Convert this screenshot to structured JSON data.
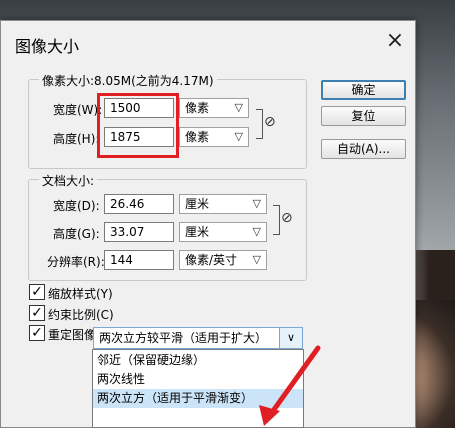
{
  "dialog": {
    "title": "图像大小",
    "close_icon": "×"
  },
  "pixel_dimensions": {
    "label": "像素大小:8.05M(之前为4.17M)",
    "width_label": "宽度(W):",
    "width_value": "1500",
    "width_unit": "像素",
    "height_label": "高度(H):",
    "height_value": "1875",
    "height_unit": "像素"
  },
  "document_size": {
    "label": "文档大小:",
    "width_label": "宽度(D):",
    "width_value": "26.46",
    "width_unit": "厘米",
    "height_label": "高度(G):",
    "height_value": "33.07",
    "height_unit": "厘米",
    "resolution_label": "分辨率(R):",
    "resolution_value": "144",
    "resolution_unit": "像素/英寸"
  },
  "buttons": {
    "ok": "确定",
    "reset": "复位",
    "auto": "自动(A)..."
  },
  "options": {
    "scale_styles": "缩放样式(Y)",
    "constrain_proportions": "约束比例(C)",
    "resample": "重定图像像素(I):"
  },
  "resample_method": {
    "selected": "两次立方较平滑（适用于扩大）",
    "items": [
      "邻近（保留硬边缘）",
      "两次线性",
      "两次立方（适用于平滑渐变）"
    ]
  },
  "colors": {
    "highlight_box": "#e01e24",
    "default_button_border": "#3c7fb1",
    "dropdown_border": "#7aa7d6"
  }
}
